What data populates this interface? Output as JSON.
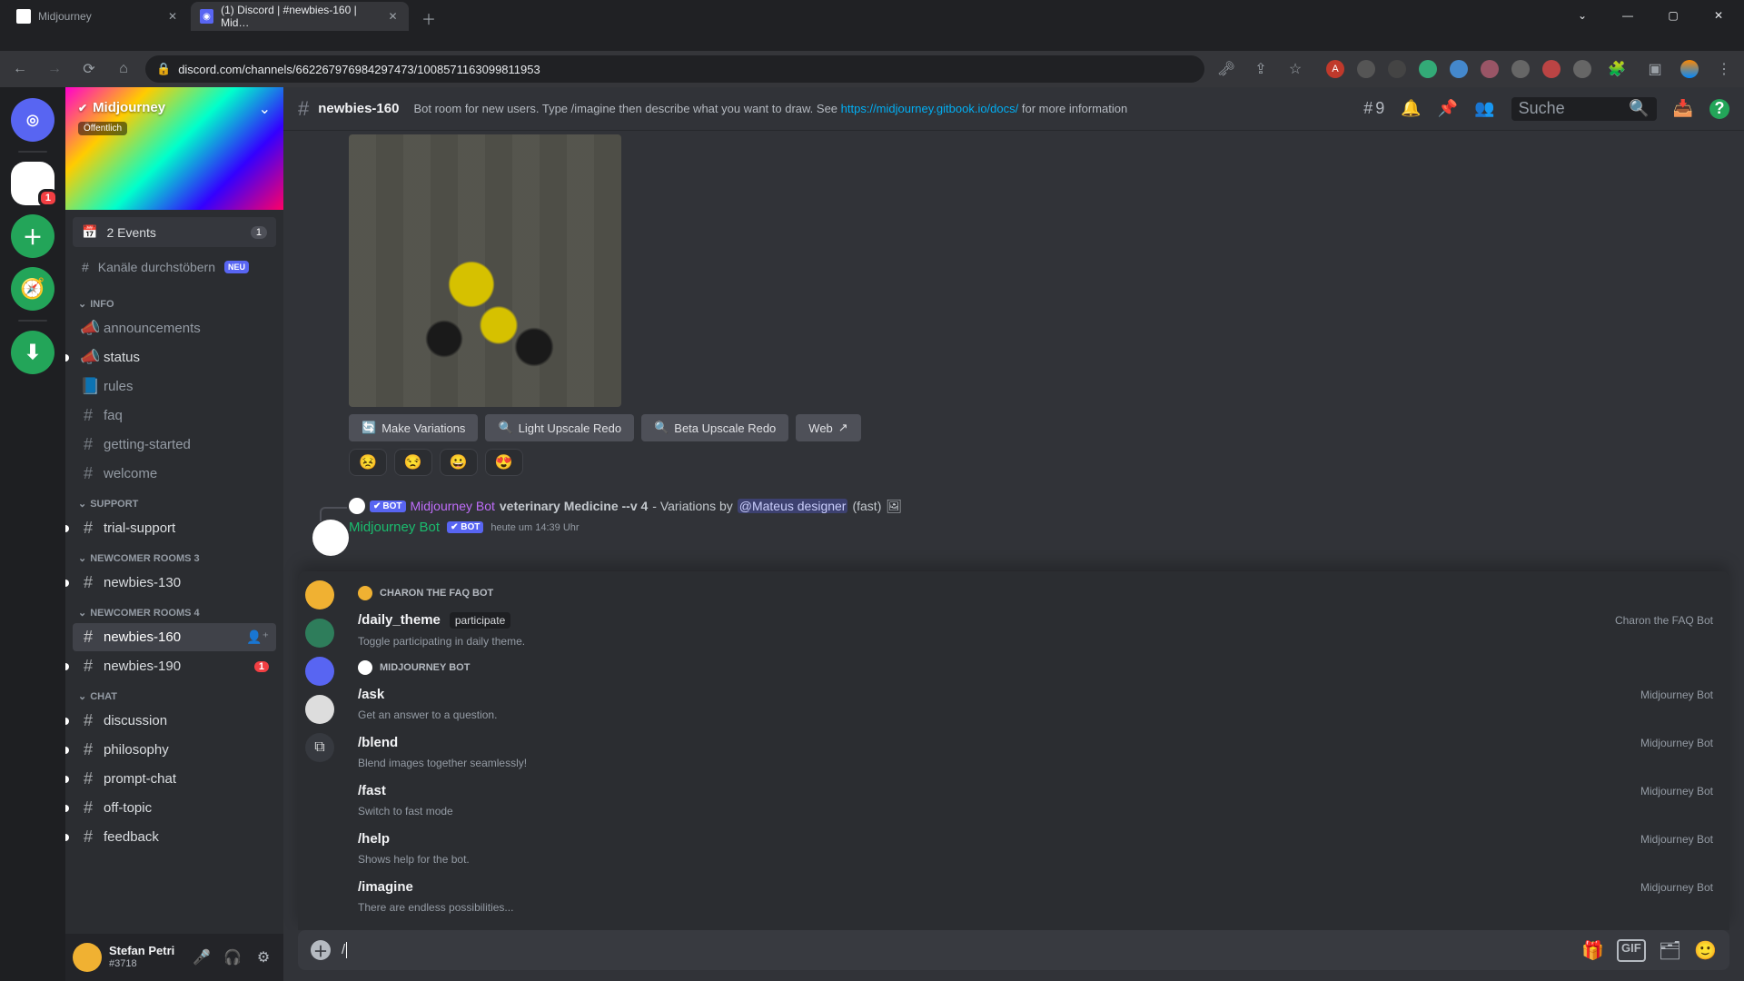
{
  "browser": {
    "tabs": [
      {
        "label": "Midjourney"
      },
      {
        "label": "(1) Discord | #newbies-160 | Mid…"
      }
    ],
    "url": "discord.com/channels/662267976984297473/1008571163099811953",
    "window": {
      "min": "—",
      "max": "▢",
      "close": "✕",
      "chev": "⌄"
    }
  },
  "discord": {
    "server_name": "Midjourney",
    "server_public": "Öffentlich",
    "events": {
      "icon": "📅",
      "label": "2 Events",
      "count": "1"
    },
    "browse": {
      "icon": "#",
      "label": "Kanäle durchstöbern",
      "badge": "NEU"
    },
    "cats": {
      "info": "INFO",
      "support": "SUPPORT",
      "nr3": "NEWCOMER ROOMS 3",
      "nr4": "NEWCOMER ROOMS 4",
      "chat": "CHAT"
    },
    "channels": {
      "info": [
        {
          "name": "announcements",
          "icon": "📣"
        },
        {
          "name": "status",
          "icon": "📣",
          "unread": true
        },
        {
          "name": "rules",
          "icon": "📘"
        },
        {
          "name": "faq",
          "icon": "#"
        },
        {
          "name": "getting-started",
          "icon": "#"
        },
        {
          "name": "welcome",
          "icon": "#"
        }
      ],
      "support": [
        {
          "name": "trial-support",
          "icon": "#",
          "unread": true
        }
      ],
      "nr3": [
        {
          "name": "newbies-130",
          "icon": "#",
          "unread": true
        }
      ],
      "nr4": [
        {
          "name": "newbies-160",
          "icon": "#",
          "selected": true
        },
        {
          "name": "newbies-190",
          "icon": "#",
          "unread": true,
          "badge": "1"
        }
      ],
      "chat": [
        {
          "name": "discussion",
          "icon": "#",
          "unread": true
        },
        {
          "name": "philosophy",
          "icon": "#",
          "unread": true
        },
        {
          "name": "prompt-chat",
          "icon": "#",
          "unread": true
        },
        {
          "name": "off-topic",
          "icon": "#",
          "unread": true
        },
        {
          "name": "feedback",
          "icon": "#",
          "unread": true
        }
      ]
    },
    "user": {
      "name": "Stefan Petri",
      "tag": "#3718"
    },
    "topbar": {
      "channel": "newbies-160",
      "topic_pre": "Bot room for new users. Type /imagine then describe what you want to draw. See ",
      "topic_link": "https://midjourney.gitbook.io/docs/",
      "topic_post": " for more information",
      "thread_count": "9",
      "search_ph": "Suche"
    },
    "msg": {
      "buttons": {
        "variations": "Make Variations",
        "light": "Light Upscale Redo",
        "beta": "Beta Upscale Redo",
        "web": "Web"
      },
      "reacts": [
        "😣",
        "😒",
        "😀",
        "😍"
      ],
      "reply": {
        "bot_name": "Midjourney Bot",
        "bot_tag": "BOT",
        "text1": "veterinary Medicine --v 4",
        "text2": "- Variations by",
        "mention": "@Mateus designer",
        "tail": "(fast)"
      },
      "header": {
        "name": "Midjourney Bot",
        "bot_tag": "✔ BOT",
        "time": "heute um 14:39 Uhr"
      }
    },
    "autocomplete": {
      "sec1": "CHARON THE FAQ BOT",
      "sec2": "MIDJOURNEY BOT",
      "src_charon": "Charon the FAQ Bot",
      "src_mj": "Midjourney Bot",
      "items": [
        {
          "cmd": "/daily_theme",
          "arg": "participate",
          "desc": "Toggle participating in daily theme."
        },
        {
          "cmd": "/ask",
          "desc": "Get an answer to a question."
        },
        {
          "cmd": "/blend",
          "desc": "Blend images together seamlessly!"
        },
        {
          "cmd": "/fast",
          "desc": "Switch to fast mode"
        },
        {
          "cmd": "/help",
          "desc": "Shows help for the bot."
        },
        {
          "cmd": "/imagine",
          "desc": "There are endless possibilities..."
        }
      ]
    },
    "composer": {
      "typed": "/"
    }
  }
}
